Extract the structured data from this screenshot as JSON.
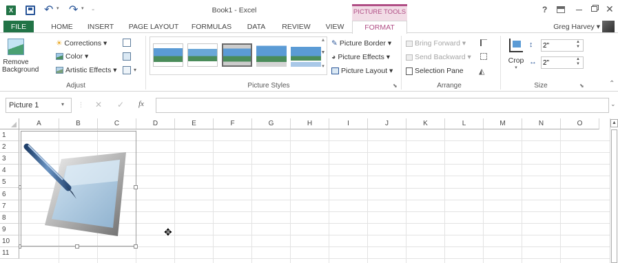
{
  "title": {
    "document": "Book1 - Excel",
    "context_tab_group": "PICTURE TOOLS",
    "help": "?",
    "user": "Greg Harvey"
  },
  "tabs": [
    "FILE",
    "HOME",
    "INSERT",
    "PAGE LAYOUT",
    "FORMULAS",
    "DATA",
    "REVIEW",
    "VIEW",
    "FORMAT"
  ],
  "ribbon": {
    "adjust": {
      "remove_background_1": "Remove",
      "remove_background_2": "Background",
      "corrections": "Corrections",
      "color": "Color",
      "artistic_effects": "Artistic Effects",
      "label": "Adjust"
    },
    "styles": {
      "picture_border": "Picture Border",
      "picture_effects": "Picture Effects",
      "picture_layout": "Picture Layout",
      "label": "Picture Styles"
    },
    "arrange": {
      "bring_forward": "Bring Forward",
      "send_backward": "Send Backward",
      "selection_pane": "Selection Pane",
      "label": "Arrange"
    },
    "size": {
      "crop": "Crop",
      "height": "2\"",
      "width": "2\"",
      "label": "Size"
    }
  },
  "formula_bar": {
    "name_box": "Picture 1",
    "fx": "fx",
    "cancel": "✕",
    "enter": "✓",
    "value": ""
  },
  "grid": {
    "columns": [
      "A",
      "B",
      "C",
      "D",
      "E",
      "F",
      "G",
      "H",
      "I",
      "J",
      "K",
      "L",
      "M",
      "N",
      "O"
    ],
    "rows": [
      "1",
      "2",
      "3",
      "4",
      "5",
      "6",
      "7",
      "8",
      "9",
      "10",
      "11"
    ]
  },
  "colors": {
    "accent": "#217346",
    "context": "#f2dce6",
    "context_text": "#b04e85"
  }
}
